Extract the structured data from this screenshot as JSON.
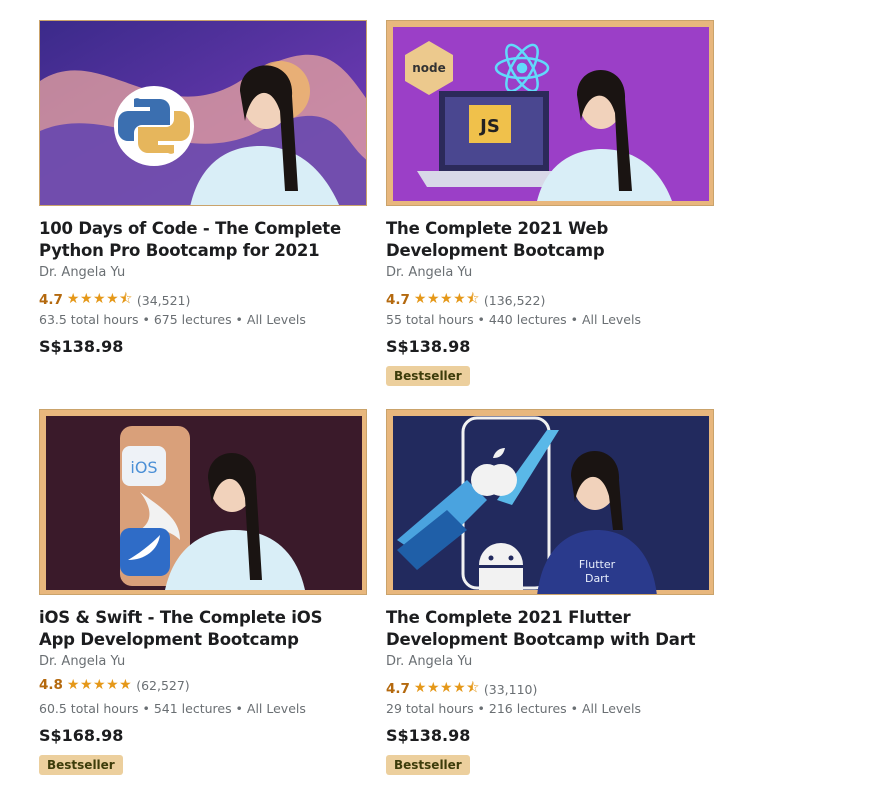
{
  "courses": [
    {
      "title": "100 Days of Code - The Complete Python Pro Bootcamp for 2021",
      "author": "Dr. Angela Yu",
      "rating": "4.7",
      "stars": "★★★★⯪",
      "reviews": "(34,521)",
      "meta": "63.5 total hours • 675 lectures • All Levels",
      "price": "S$138.98",
      "badge": "",
      "thumb_icon": "python-logo-icon"
    },
    {
      "title": "The Complete 2021 Web Development Bootcamp",
      "author": "Dr. Angela Yu",
      "rating": "4.7",
      "stars": "★★★★⯪",
      "reviews": "(136,522)",
      "meta": "55 total hours • 440 lectures • All Levels",
      "price": "S$138.98",
      "badge": "Bestseller",
      "thumb_icon": "javascript-node-react-icon",
      "thumb_labels": [
        "node",
        "JS"
      ]
    },
    {
      "title": "iOS & Swift - The Complete iOS App Development Bootcamp",
      "author": "Dr. Angela Yu",
      "rating": "4.8",
      "stars": "★★★★★",
      "reviews": "(62,527)",
      "meta": "60.5 total hours • 541 lectures • All Levels",
      "price": "S$168.98",
      "badge": "Bestseller",
      "thumb_icon": "swift-ios-icon",
      "thumb_labels": [
        "iOS"
      ]
    },
    {
      "title": "The Complete 2021 Flutter Development Bootcamp with Dart",
      "author": "Dr. Angela Yu",
      "rating": "4.7",
      "stars": "★★★★⯪",
      "reviews": "(33,110)",
      "meta": "29 total hours • 216 lectures • All Levels",
      "price": "S$138.98",
      "badge": "Bestseller",
      "thumb_icon": "flutter-apple-android-icon",
      "thumb_labels": [
        "Flutter",
        "Dart"
      ]
    }
  ],
  "colors": {
    "rating": "#b4690e",
    "star": "#e59819",
    "badge_bg": "#eccf9d",
    "thumb_border": "#caa36b"
  }
}
